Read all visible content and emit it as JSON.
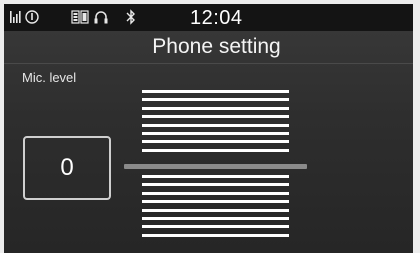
{
  "status_bar": {
    "icons": [
      "signal-strength-icon",
      "phone-battery-icon",
      "phone-device-icon",
      "headset-icon",
      "bluetooth-icon"
    ],
    "time": "12:04"
  },
  "screen": {
    "title": "Phone setting"
  },
  "mic_level": {
    "label": "Mic. level",
    "value": "0",
    "controls": {
      "up_steps": 8,
      "down_steps": 8
    }
  },
  "colors": {
    "background": "#2e2e2e",
    "status_bar": "#141414",
    "text": "#ffffff",
    "track": "#8a8a8a"
  }
}
